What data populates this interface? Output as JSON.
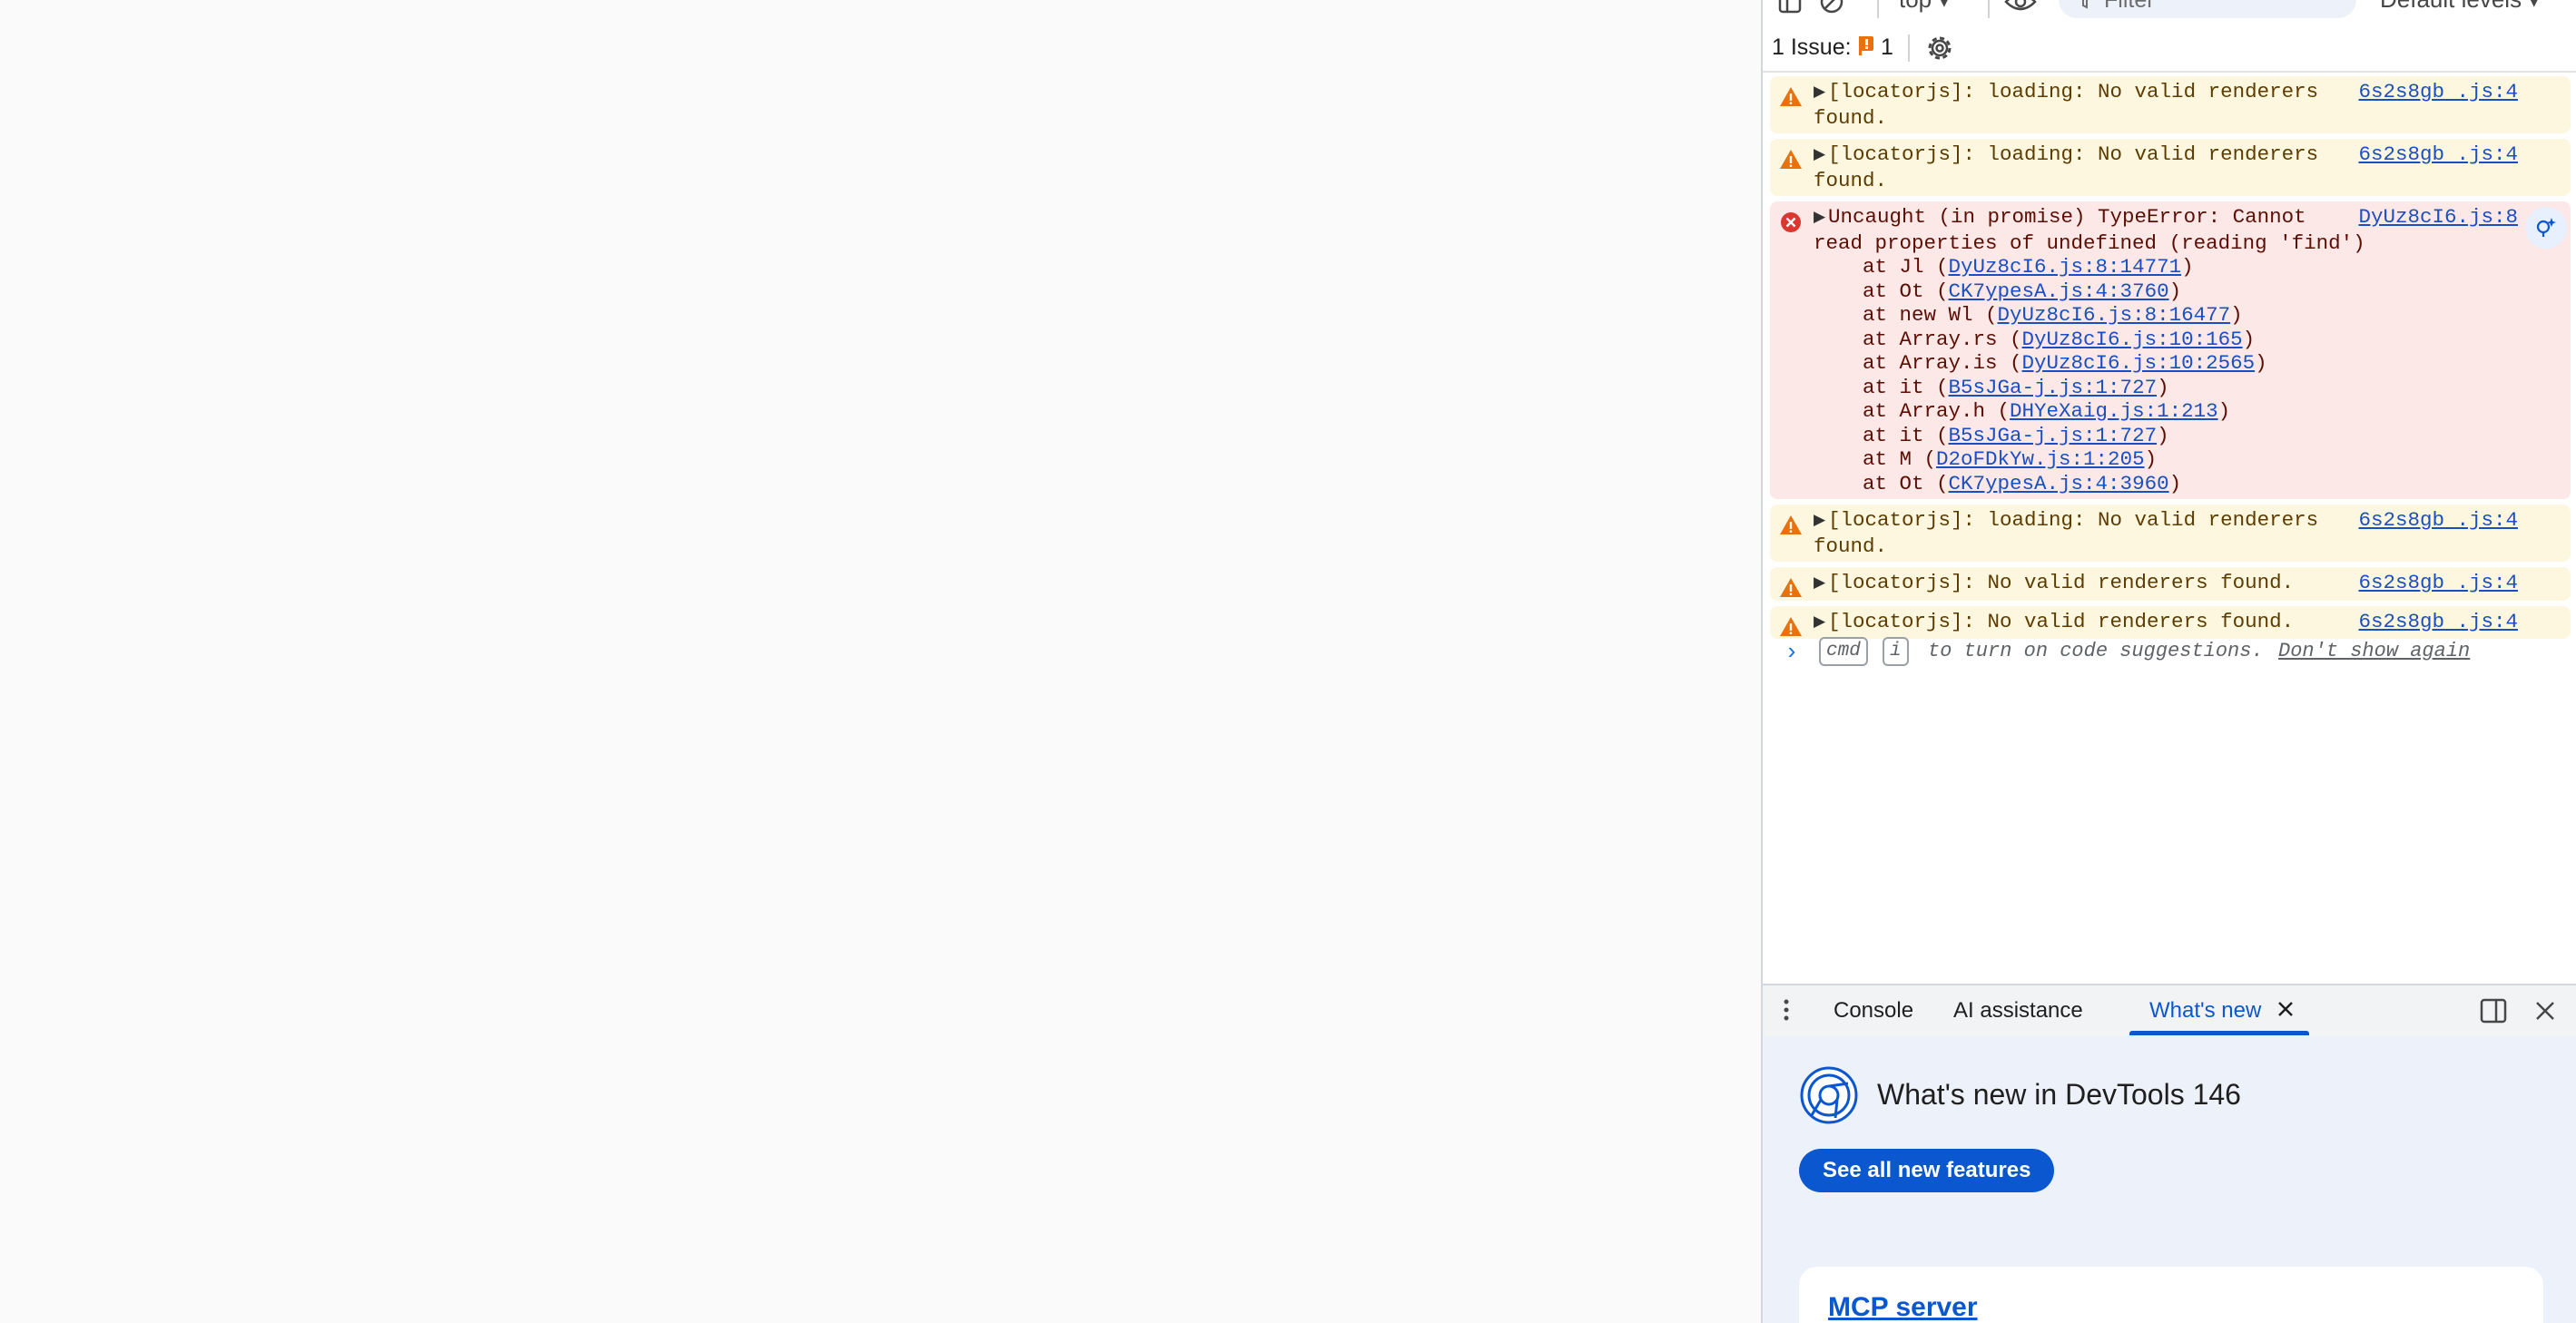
{
  "toolbar": {
    "context": "top ▾",
    "filter_placeholder": "Filter",
    "levels": "Default levels ▾"
  },
  "issues": {
    "label": "1 Issue:",
    "count": "1"
  },
  "messages": [
    {
      "level": "warning",
      "text": "[locatorjs]: loading: No valid renderers",
      "text2": "found.",
      "source": "6s2s8gb .js:4"
    },
    {
      "level": "warning",
      "text": "[locatorjs]: loading: No valid renderers",
      "text2": "found.",
      "source": "6s2s8gb .js:4"
    },
    {
      "level": "error",
      "text": "Uncaught (in promise) TypeError: Cannot",
      "text2": "read properties of undefined (reading 'find')",
      "source": "DyUz8cI6.js:8",
      "stack": [
        {
          "prefix": "    at Jl (",
          "link": "DyUz8cI6.js:8:14771",
          "suffix": ")"
        },
        {
          "prefix": "    at Ot (",
          "link": "CK7ypesA.js:4:3760",
          "suffix": ")"
        },
        {
          "prefix": "    at new Wl (",
          "link": "DyUz8cI6.js:8:16477",
          "suffix": ")"
        },
        {
          "prefix": "    at Array.rs (",
          "link": "DyUz8cI6.js:10:165",
          "suffix": ")"
        },
        {
          "prefix": "    at Array.is (",
          "link": "DyUz8cI6.js:10:2565",
          "suffix": ")"
        },
        {
          "prefix": "    at it (",
          "link": "B5sJGa-j.js:1:727",
          "suffix": ")"
        },
        {
          "prefix": "    at Array.h (",
          "link": "DHYeXaig.js:1:213",
          "suffix": ")"
        },
        {
          "prefix": "    at it (",
          "link": "B5sJGa-j.js:1:727",
          "suffix": ")"
        },
        {
          "prefix": "    at M (",
          "link": "D2oFDkYw.js:1:205",
          "suffix": ")"
        },
        {
          "prefix": "    at Ot (",
          "link": "CK7ypesA.js:4:3960",
          "suffix": ")"
        }
      ]
    },
    {
      "level": "warning",
      "text": "[locatorjs]: loading: No valid renderers",
      "text2": "found.",
      "source": "6s2s8gb .js:4"
    },
    {
      "level": "warning",
      "text": "[locatorjs]: No valid renderers found.",
      "text2": "",
      "source": "6s2s8gb .js:4"
    },
    {
      "level": "warning",
      "text": "[locatorjs]: No valid renderers found.",
      "text2": "",
      "source": "6s2s8gb .js:4"
    }
  ],
  "prompt": {
    "kbd1": "cmd",
    "kbd2": "i",
    "hint": "to turn on code suggestions.",
    "dont_show": "Don't show again"
  },
  "drawer": {
    "tabs": [
      "Console",
      "AI assistance",
      "What's new"
    ],
    "active_tab": "What's new"
  },
  "whats_new": {
    "title": "What's new in DevTools 146",
    "button": "See all new features",
    "card_title": "MCP server"
  },
  "colors": {
    "warning_bg": "#fef7e0",
    "error_bg": "#fce8e6",
    "accent": "#0b57d0",
    "link": "#1a4fc4"
  }
}
